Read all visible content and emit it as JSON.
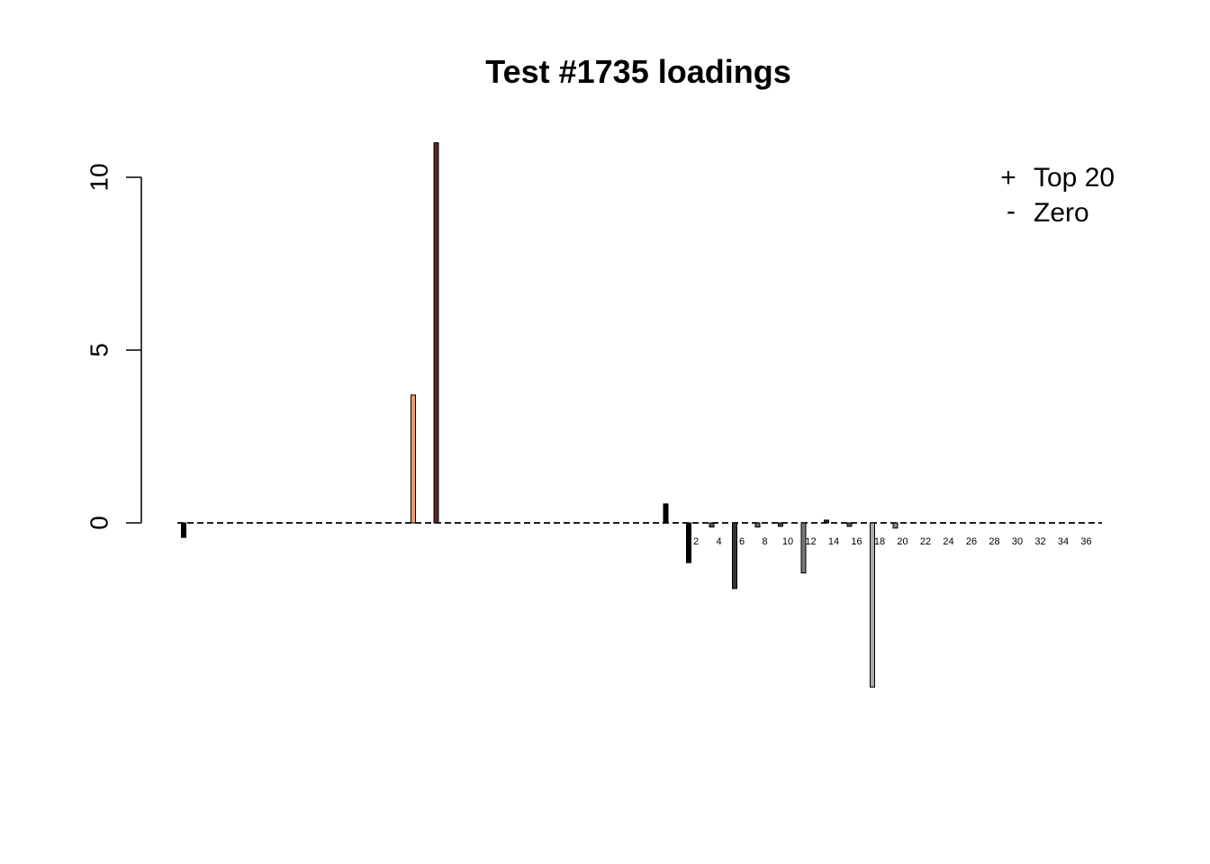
{
  "chart_data": {
    "type": "bar",
    "title": "Test #1735 loadings",
    "xlabel": "",
    "ylabel": "",
    "ylim": [
      -6.2,
      11.3
    ],
    "y_ticks": [
      0,
      5,
      10
    ],
    "grid": false,
    "baseline": {
      "value": 0,
      "style": "dashed"
    },
    "legend": {
      "placement": "top-right",
      "entries": [
        {
          "symbol": "+",
          "label": "Top 20"
        },
        {
          "symbol": "-",
          "label": "Zero"
        }
      ]
    },
    "x_tick_labels": [
      "2",
      "4",
      "6",
      "8",
      "10",
      "12",
      "14",
      "16",
      "18",
      "20",
      "22",
      "24",
      "26",
      "28",
      "30",
      "32",
      "34",
      "36"
    ],
    "bars": [
      {
        "x": 1,
        "value": -0.42,
        "color": "#000000"
      },
      {
        "x": 11,
        "value": 3.7,
        "color": "#E8A060"
      },
      {
        "x": 12,
        "value": 11.0,
        "color": "#5A2A1A"
      },
      {
        "x": 22,
        "value": 0.55,
        "color": "#000000"
      },
      {
        "x": 23,
        "value": -1.15,
        "color": "#000000"
      },
      {
        "x": 24,
        "value": -0.12,
        "color": "#555555"
      },
      {
        "x": 25,
        "value": -1.9,
        "color": "#333333"
      },
      {
        "x": 26,
        "value": -0.12,
        "color": "#666666"
      },
      {
        "x": 27,
        "value": -0.1,
        "color": "#444444"
      },
      {
        "x": 28,
        "value": -1.45,
        "color": "#777777"
      },
      {
        "x": 29,
        "value": 0.08,
        "color": "#222222"
      },
      {
        "x": 30,
        "value": -0.1,
        "color": "#555555"
      },
      {
        "x": 31,
        "value": -4.75,
        "color": "#AAAAAA"
      },
      {
        "x": 32,
        "value": -0.15,
        "color": "#888888"
      }
    ]
  }
}
